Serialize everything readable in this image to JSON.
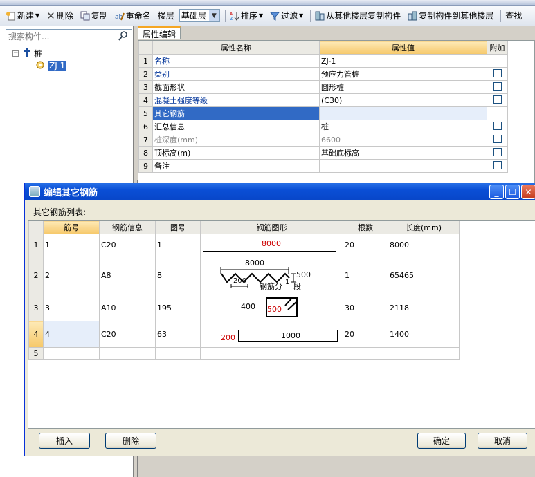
{
  "toolbar": {
    "new_label": "新建",
    "delete_label": "删除",
    "copy_label": "复制",
    "rename_label": "重命名",
    "floor_label": "楼层",
    "floor_value": "基础层",
    "sort_label": "排序",
    "filter_label": "过滤",
    "copy_from_label": "从其他楼层复制构件",
    "copy_to_label": "复制构件到其他楼层",
    "find_label": "查找"
  },
  "sidebar": {
    "search_placeholder": "搜索构件...",
    "tree_root": "桩",
    "tree_child": "ZJ-1"
  },
  "props": {
    "tab_label": "属性编辑",
    "headers": {
      "name": "属性名称",
      "value": "属性值",
      "extra": "附加"
    },
    "rows": [
      {
        "n": "1",
        "name": "名称",
        "value": "ZJ-1",
        "chk": false,
        "style": "blue"
      },
      {
        "n": "2",
        "name": "类别",
        "value": "预应力管桩",
        "chk": true,
        "style": "blue"
      },
      {
        "n": "3",
        "name": "截面形状",
        "value": "圆形桩",
        "chk": true,
        "style": ""
      },
      {
        "n": "4",
        "name": "混凝土强度等级",
        "value": "(C30)",
        "chk": true,
        "style": "blue"
      },
      {
        "n": "5",
        "name": "其它钢筋",
        "value": "",
        "chk": false,
        "style": "sel"
      },
      {
        "n": "6",
        "name": "汇总信息",
        "value": "桩",
        "chk": true,
        "style": ""
      },
      {
        "n": "7",
        "name": "桩深度(mm)",
        "value": "6600",
        "chk": true,
        "style": "grey"
      },
      {
        "n": "8",
        "name": "顶标高(m)",
        "value": "基础底标高",
        "chk": true,
        "style": ""
      },
      {
        "n": "9",
        "name": "备注",
        "value": "",
        "chk": true,
        "style": ""
      }
    ]
  },
  "dialog": {
    "title": "编辑其它钢筋",
    "list_label": "其它钢筋列表:",
    "headers": {
      "no": "筋号",
      "info": "钢筋信息",
      "fig": "图号",
      "shape": "钢筋图形",
      "count": "根数",
      "len": "长度(mm)"
    },
    "rows": [
      {
        "rn": "1",
        "no": "1",
        "info": "C20",
        "fig": "1",
        "count": "20",
        "len": "8000"
      },
      {
        "rn": "2",
        "no": "2",
        "info": "A8",
        "fig": "8",
        "count": "1",
        "len": "65465"
      },
      {
        "rn": "3",
        "no": "3",
        "info": "A10",
        "fig": "195",
        "count": "30",
        "len": "2118"
      },
      {
        "rn": "4",
        "no": "4",
        "info": "C20",
        "fig": "63",
        "count": "20",
        "len": "1400"
      },
      {
        "rn": "5",
        "no": "",
        "info": "",
        "fig": "",
        "count": "",
        "len": ""
      }
    ],
    "shapes": {
      "s1_len": "8000",
      "s2_len": "8000",
      "s2_h": "500",
      "s2_pitch": "200",
      "s2_seg": "钢筋分",
      "s2_seg_n": "1",
      "s2_seg_suffix": "段",
      "s3_a": "400",
      "s3_b": "500",
      "s4_a": "200",
      "s4_b": "1000"
    },
    "buttons": {
      "insert": "插入",
      "delete": "删除",
      "ok": "确定",
      "cancel": "取消"
    }
  },
  "colors": {
    "red": "#cc0000",
    "accent": "#316ac5"
  }
}
